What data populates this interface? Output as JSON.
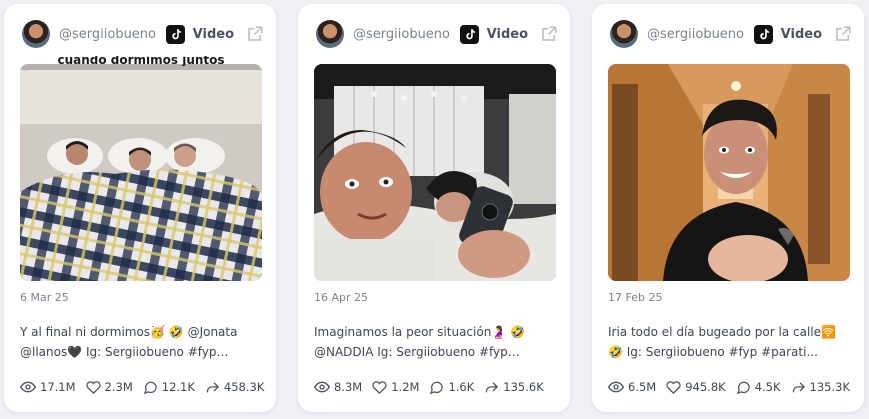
{
  "cards": [
    {
      "handle": "@sergiiobueno",
      "platform": "Video",
      "date": "6 Mar 25",
      "caption": "Y al final ni dormimos🥳 🤣 @Jonata @llanos🖤 Ig: Sergiiobueno #fyp #para...",
      "views": "17.1M",
      "likes": "2.3M",
      "comments": "12.1K",
      "shares": "458.3K",
      "overlay_text": "cuando dormimos juntos"
    },
    {
      "handle": "@sergiiobueno",
      "platform": "Video",
      "date": "16 Apr 25",
      "caption": "Imaginamos la peor situación🤰 🤣 @NADDIA Ig: Sergiiobueno #fyp #parati...",
      "views": "8.3M",
      "likes": "1.2M",
      "comments": "1.6K",
      "shares": "135.6K"
    },
    {
      "handle": "@sergiiobueno",
      "platform": "Video",
      "date": "17 Feb 25",
      "caption": "Iria todo el día bugeado por la calle🛜 🤣 Ig: Sergiiobueno #fyp #parati...",
      "views": "6.5M",
      "likes": "945.8K",
      "comments": "4.5K",
      "shares": "135.3K"
    }
  ],
  "icons": {
    "platform": "tiktok-icon",
    "external": "external-link-icon",
    "views": "eye-icon",
    "likes": "heart-icon",
    "comments": "comment-icon",
    "shares": "share-icon"
  }
}
